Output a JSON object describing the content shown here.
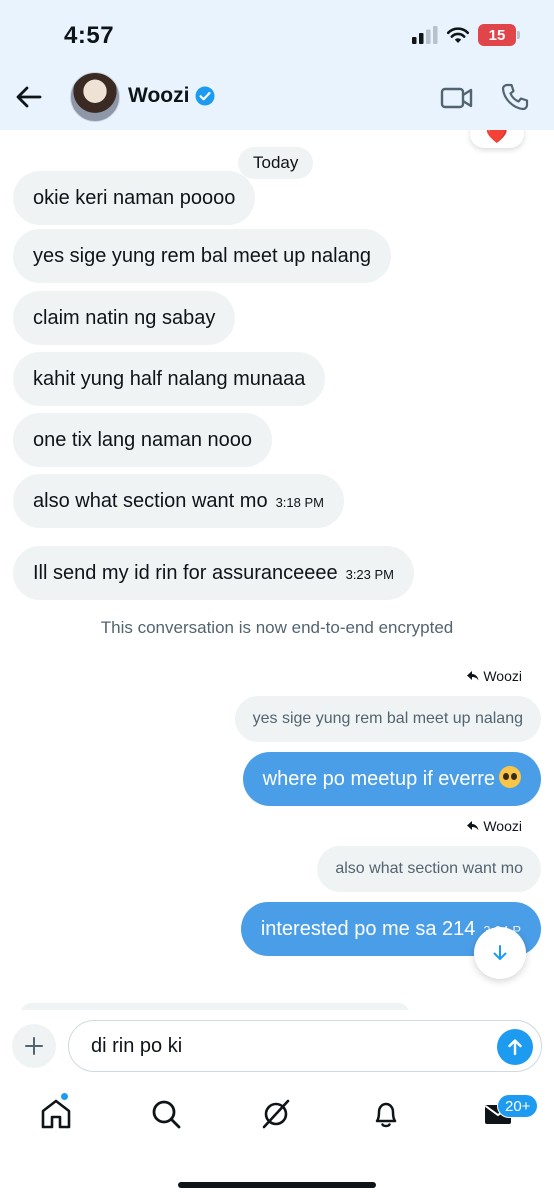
{
  "status": {
    "time": "4:57",
    "battery": "15"
  },
  "header": {
    "name": "Woozi"
  },
  "chat": {
    "reaction": "❤️",
    "day_label": "Today",
    "incoming": [
      {
        "text": "okie keri naman poooo",
        "time": ""
      },
      {
        "text": "yes sige yung rem bal meet up nalang",
        "time": ""
      },
      {
        "text": "claim natin ng sabay",
        "time": ""
      },
      {
        "text": "kahit yung half nalang munaaa",
        "time": ""
      },
      {
        "text": "one tix lang naman nooo",
        "time": ""
      },
      {
        "text": "also what section want mo",
        "time": "3:18 PM"
      },
      {
        "text": "Ill send my id rin for assuranceeee",
        "time": "3:23 PM"
      }
    ],
    "system_message": "This conversation is now end-to-end encrypted",
    "outgoing": [
      {
        "reply_to": "Woozi",
        "quote": "yes sige yung rem bal meet up nalang",
        "text": "where po meetup if everre",
        "time": ""
      },
      {
        "reply_to": "Woozi",
        "quote": "also what section want mo",
        "text": "interested po me sa 214",
        "time": "3:24 P"
      }
    ]
  },
  "composer": {
    "value": "di rin po ki"
  },
  "tabs": {
    "messages_badge": "20+"
  },
  "colors": {
    "accent": "#1d9bf0",
    "outgoing_bubble": "#4a9ee8",
    "incoming_bubble": "#eff3f4",
    "header_bg": "#e8f3fd"
  }
}
